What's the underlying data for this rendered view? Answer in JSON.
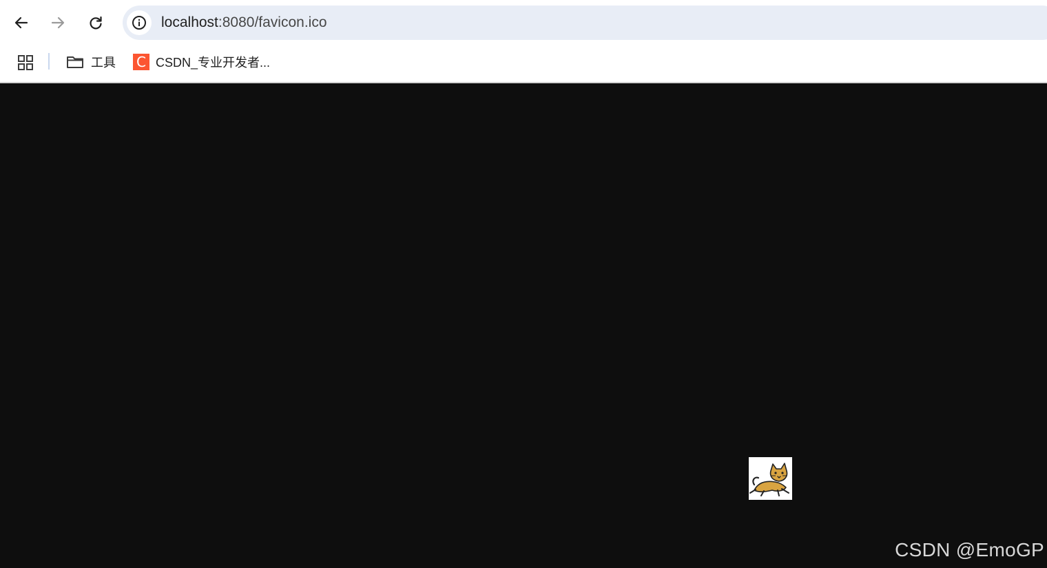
{
  "toolbar": {
    "back_icon": "arrow-left-icon",
    "forward_icon": "arrow-right-icon",
    "reload_icon": "reload-icon",
    "site_info_icon": "info-circle-icon",
    "url_host": "localhost",
    "url_rest": ":8080/favicon.ico"
  },
  "bookmarks": {
    "apps_icon": "apps-grid-icon",
    "items": [
      {
        "label": "工具",
        "icon": "folder-icon"
      },
      {
        "label": "CSDN_专业开发者...",
        "icon": "csdn-icon",
        "icon_text": "C",
        "icon_color": "#fc5531"
      }
    ]
  },
  "content": {
    "background": "#0e0e0e",
    "image_icon": "tomcat-cat-icon",
    "watermark": "CSDN @EmoGP"
  }
}
